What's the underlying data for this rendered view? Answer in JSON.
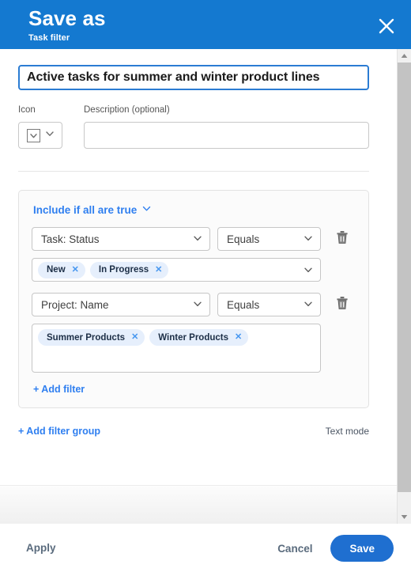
{
  "header": {
    "title": "Save as",
    "subtitle": "Task filter",
    "close_icon": "close-icon",
    "bg_color": "#1479d0"
  },
  "name": {
    "value": "Active tasks for summer and winter product lines",
    "placeholder": "Name"
  },
  "meta": {
    "icon_label": "Icon",
    "icon_glyph": "⌄",
    "icon_chevron": "chevron-down-icon",
    "description_label": "Description (optional)",
    "description_value": "",
    "description_placeholder": ""
  },
  "filter_group": {
    "mode_label": "Include if all are true",
    "mode_chevron": "chevron-down-icon",
    "add_filter_label": "+ Add filter",
    "rows": [
      {
        "field": "Task: Status",
        "operator": "Equals",
        "values": [
          "New",
          "In Progress"
        ],
        "multiline": false,
        "has_chevron": true,
        "delete_icon": "trash-icon"
      },
      {
        "field": "Project: Name",
        "operator": "Equals",
        "values": [
          "Summer Products",
          "Winter Products"
        ],
        "multiline": true,
        "has_chevron": false,
        "delete_icon": "trash-icon"
      }
    ]
  },
  "group_links": {
    "add_group_label": "+ Add filter group",
    "text_mode_label": "Text mode"
  },
  "footer": {
    "apply_label": "Apply",
    "cancel_label": "Cancel",
    "save_label": "Save",
    "save_color": "#1f6fd0"
  },
  "scrollbar": {
    "up_icon": "scroll-up-arrow-icon",
    "down_icon": "scroll-down-arrow-icon"
  },
  "colors": {
    "accent": "#1479d0",
    "link": "#2f7ff0",
    "chip_bg": "#e6effc",
    "chip_text": "#1d2f47"
  }
}
